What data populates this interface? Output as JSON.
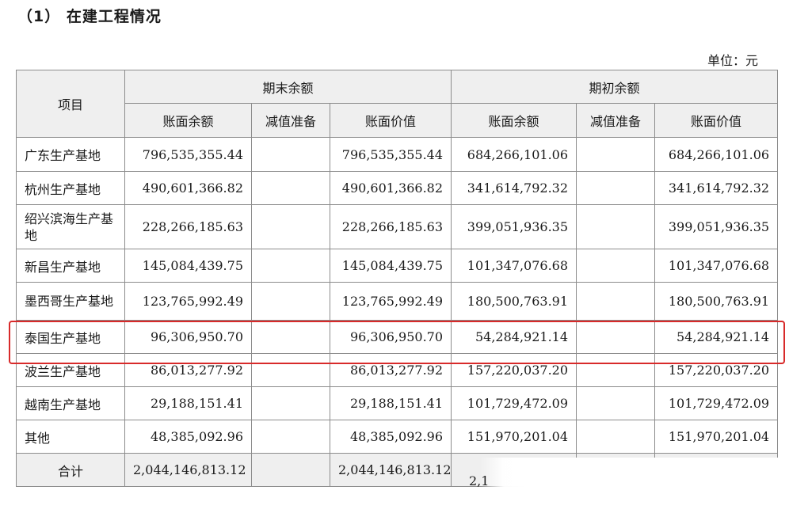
{
  "title": "（1） 在建工程情况",
  "unit": "单位：元",
  "header": {
    "item": "项目",
    "end_balance": "期末余额",
    "begin_balance": "期初余额",
    "book_balance": "账面余额",
    "impairment": "减值准备",
    "book_value": "账面价值"
  },
  "rows": [
    {
      "name": "广东生产基地",
      "end_book": "796,535,355.44",
      "end_imp": "",
      "end_val": "796,535,355.44",
      "begin_book": "684,266,101.06",
      "begin_imp": "",
      "begin_val": "684,266,101.06"
    },
    {
      "name": "杭州生产基地",
      "end_book": "490,601,366.82",
      "end_imp": "",
      "end_val": "490,601,366.82",
      "begin_book": "341,614,792.32",
      "begin_imp": "",
      "begin_val": "341,614,792.32"
    },
    {
      "name": "绍兴滨海生产基地",
      "end_book": "228,266,185.63",
      "end_imp": "",
      "end_val": "228,266,185.63",
      "begin_book": "399,051,936.35",
      "begin_imp": "",
      "begin_val": "399,051,936.35"
    },
    {
      "name": "新昌生产基地",
      "end_book": "145,084,439.75",
      "end_imp": "",
      "end_val": "145,084,439.75",
      "begin_book": "101,347,076.68",
      "begin_imp": "",
      "begin_val": "101,347,076.68"
    },
    {
      "name": "墨西哥生产基地",
      "end_book": "123,765,992.49",
      "end_imp": "",
      "end_val": "123,765,992.49",
      "begin_book": "180,500,763.91",
      "begin_imp": "",
      "begin_val": "180,500,763.91"
    },
    {
      "name": "泰国生产基地",
      "end_book": "96,306,950.70",
      "end_imp": "",
      "end_val": "96,306,950.70",
      "begin_book": "54,284,921.14",
      "begin_imp": "",
      "begin_val": "54,284,921.14"
    },
    {
      "name": "波兰生产基地",
      "end_book": "86,013,277.92",
      "end_imp": "",
      "end_val": "86,013,277.92",
      "begin_book": "157,220,037.20",
      "begin_imp": "",
      "begin_val": "157,220,037.20"
    },
    {
      "name": "越南生产基地",
      "end_book": "29,188,151.41",
      "end_imp": "",
      "end_val": "29,188,151.41",
      "begin_book": "101,729,472.09",
      "begin_imp": "",
      "begin_val": "101,729,472.09"
    },
    {
      "name": "其他",
      "end_book": "48,385,092.96",
      "end_imp": "",
      "end_val": "48,385,092.96",
      "begin_book": "151,970,201.04",
      "begin_imp": "",
      "begin_val": "151,970,201.04"
    }
  ],
  "total": {
    "name": "合计",
    "end_book": "2,044,146,813.12",
    "end_imp": "",
    "end_val": "2,044,146,813.12",
    "begin_book_partial": "2,1"
  },
  "highlight_color": "#d82a2a"
}
